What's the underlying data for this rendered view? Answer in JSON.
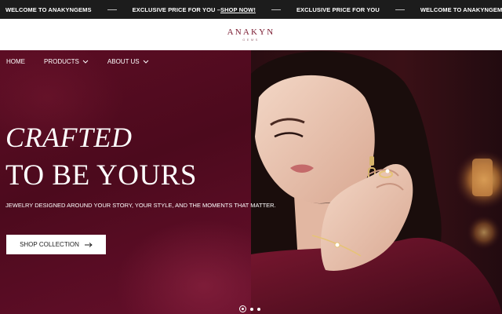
{
  "announcement": {
    "items": [
      {
        "text": "WELCOME TO ANAKYNGEMS"
      },
      {
        "text": "EXCLUSIVE PRICE FOR YOU –",
        "link": "SHOP NOW!"
      },
      {
        "text": "EXCLUSIVE PRICE FOR YOU"
      },
      {
        "text": "WELCOME TO ANAKYNGEMS"
      }
    ]
  },
  "logo": {
    "name": "ANAKYN",
    "sub": "GEMS"
  },
  "nav": {
    "home": "HOME",
    "products": "PRODUCTS",
    "about": "ABOUT US"
  },
  "hero": {
    "headline_italic": "CRAFTED",
    "headline": "TO BE YOURS",
    "subtext": "JEWELRY DESIGNED AROUND YOUR STORY, YOUR STYLE, AND THE MOMENTS THAT MATTER.",
    "cta_label": "SHOP COLLECTION",
    "cta_icon": "arrow-right-icon",
    "image_icon": "model-wearing-jewelry-photo"
  },
  "slider": {
    "count": 3,
    "active": 1
  },
  "colors": {
    "topbar": "#1c1c1c",
    "brand": "#7a1a30",
    "hero_bg": "#5c0d24",
    "cta_bg": "#ffffff"
  }
}
